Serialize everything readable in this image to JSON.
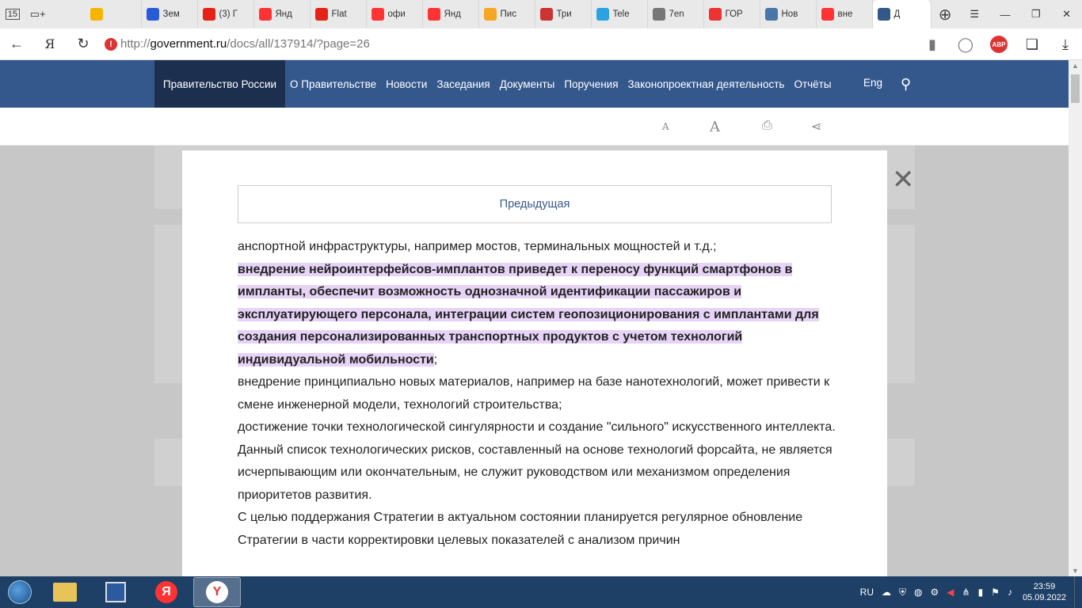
{
  "browser": {
    "tab_counter": "15",
    "tabs": [
      {
        "label": "",
        "color": "#f5b400",
        "icon": "play-icon"
      },
      {
        "label": "Зем",
        "color": "#2a5bd7",
        "icon": "vf-icon"
      },
      {
        "label": "(3) Г",
        "color": "#e62117",
        "icon": "youtube-icon"
      },
      {
        "label": "Янд",
        "color": "#f33",
        "icon": "yandex-icon"
      },
      {
        "label": "Flat",
        "color": "#e62117",
        "icon": "youtube-icon"
      },
      {
        "label": "офи",
        "color": "#f33",
        "icon": "yandex-icon"
      },
      {
        "label": "Янд",
        "color": "#f33",
        "icon": "yandex-icon"
      },
      {
        "label": "Пис",
        "color": "#f5a623",
        "icon": "mail-icon"
      },
      {
        "label": "Три",
        "color": "#c33",
        "icon": "bug-icon"
      },
      {
        "label": "Tele",
        "color": "#2aa3e0",
        "icon": "telegram-icon"
      },
      {
        "label": "7en",
        "color": "#777",
        "icon": "doc-icon"
      },
      {
        "label": "ГОР",
        "color": "#e33",
        "icon": "zen-icon"
      },
      {
        "label": "Нов",
        "color": "#4a76a8",
        "icon": "vk-icon"
      },
      {
        "label": "вне",
        "color": "#f33",
        "icon": "yandex-icon"
      },
      {
        "label": "Д",
        "color": "#35588c",
        "icon": "gov-icon"
      }
    ],
    "address_prefix": "http://",
    "address_host": "government.ru",
    "address_path": "/docs/all/137914/?page=26",
    "abp_label": "ABP"
  },
  "site": {
    "brand": "Правительство России",
    "nav": [
      "О Правительстве",
      "Новости",
      "Заседания",
      "Документы",
      "Поручения",
      "Законопроектная деятельность",
      "Отчёты"
    ],
    "eng": "Eng",
    "tools": {
      "font_small": "A",
      "font_large": "A"
    }
  },
  "modal": {
    "prev_label": "Предыдущая",
    "p0": "анспортной инфраструктуры, например мостов, терминальных мощностей и т.д.;",
    "p1_highlight": "внедрение нейроинтерфейсов-имплантов приведет к переносу функций смартфонов в импланты, обеспечит возможность однозначной идентификации пассажиров и эксплуатирующего персонала, интеграции систем геопозиционирования с имплантами для создания персонализированных транспортных продуктов с учетом технологий индивидуальной мобильности",
    "p1_tail": ";",
    "p2": "внедрение принципиально новых материалов, например на базе нанотехнологий, может привести к смене инженерной модели, технологий строительства;",
    "p3": "достижение точки технологической сингулярности и создание \"сильного\" искусственного интеллекта.",
    "p4": "Данный список технологических рисков, составленный на основе технологий форсайта, не является исчерпывающим или окончательным, не служит руководством или механизмом определения приоритетов развития.",
    "p5": "С целью поддержания Стратегии в актуальном состоянии планируется регулярное обновление Стратегии в части корректировки целевых показателей с анализом причин"
  },
  "taskbar": {
    "lang": "RU",
    "time": "23:59",
    "date": "05.09.2022"
  }
}
